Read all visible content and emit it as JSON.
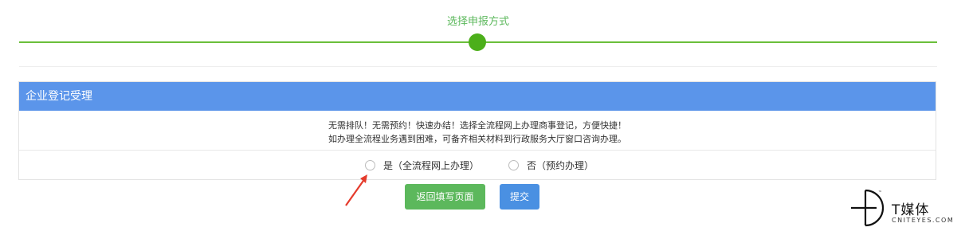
{
  "progress": {
    "step_label": "选择申报方式",
    "accent_color": "#4caf1a"
  },
  "panel": {
    "title": "企业登记受理",
    "message_line1": "无需排队！无需预约！快速办结！选择全流程网上办理商事登记，方便快捷！",
    "message_line2": "如办理全流程业务遇到困难，可备齐相关材料到行政服务大厅窗口咨询办理。",
    "options": [
      {
        "label": "是（全流程网上办理）",
        "selected": false
      },
      {
        "label": "否（预约办理）",
        "selected": false
      }
    ],
    "header_color": "#5b95ea"
  },
  "actions": {
    "back_label": "返回填写页面",
    "submit_label": "提交"
  },
  "watermark": {
    "title": "T媒体",
    "subtitle": "CNITEYES.COM",
    "tm": "™"
  }
}
